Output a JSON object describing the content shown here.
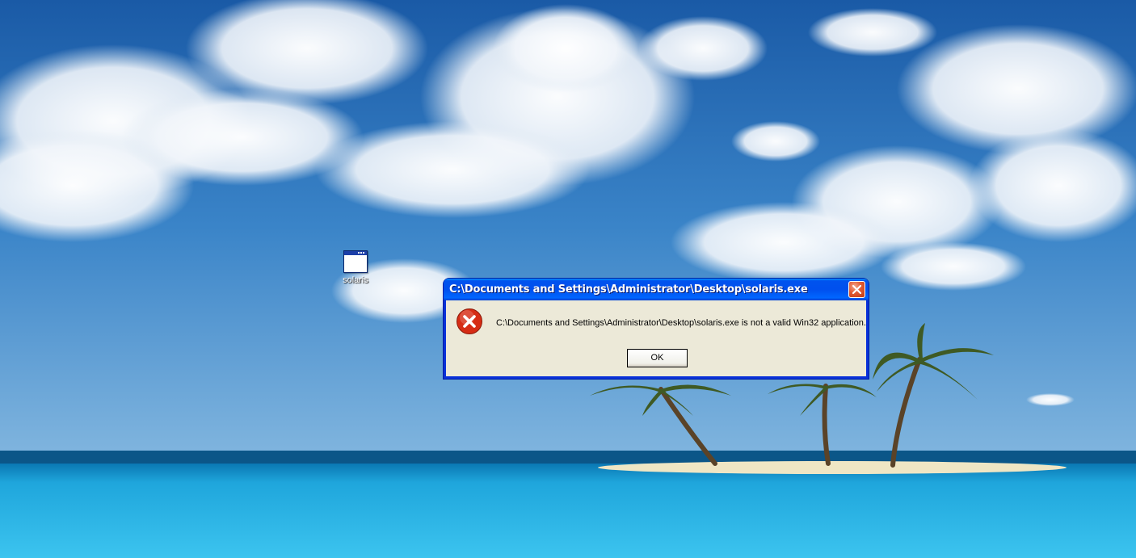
{
  "desktop": {
    "icons": [
      {
        "label": "solaris",
        "icon": "application-window-icon"
      }
    ]
  },
  "dialog": {
    "title": "C:\\Documents and Settings\\Administrator\\Desktop\\solaris.exe",
    "message": "C:\\Documents and Settings\\Administrator\\Desktop\\solaris.exe is not a valid Win32 application.",
    "icon": "error-icon",
    "ok_label": "OK",
    "close_icon": "close-icon"
  },
  "colors": {
    "titlebar": "#0054e3",
    "client": "#ece9d8",
    "error_red": "#d62c14"
  }
}
